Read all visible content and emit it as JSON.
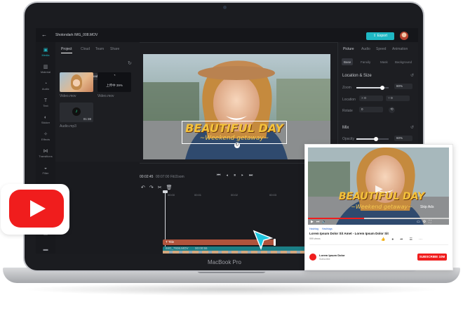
{
  "device": {
    "brand": "MacBook Pro"
  },
  "topbar": {
    "filename": "Shotondark IMG_008.MOV",
    "export_label": "Export"
  },
  "rail": {
    "items": [
      {
        "label": "Media",
        "icon": "media-icon"
      },
      {
        "label": "Material",
        "icon": "material-icon"
      },
      {
        "label": "Audio",
        "icon": "audio-icon"
      },
      {
        "label": "Text",
        "icon": "text-icon"
      },
      {
        "label": "Sticker",
        "icon": "sticker-icon"
      },
      {
        "label": "Effects",
        "icon": "effects-icon"
      },
      {
        "label": "Transitions",
        "icon": "transitions-icon"
      },
      {
        "label": "Filter",
        "icon": "filter-icon"
      }
    ]
  },
  "media_panel": {
    "tabs": [
      "Project",
      "Cloud",
      "Team",
      "Share"
    ],
    "upload_label": "Upload",
    "items": [
      {
        "name": "Video.mov"
      },
      {
        "name": "Video.mov",
        "overlay": "上传中 39%"
      },
      {
        "name": "Audio.mp3",
        "duration": "01:38"
      }
    ]
  },
  "right_panel": {
    "tabs": [
      "Picture",
      "Audio",
      "Speed",
      "Animation"
    ],
    "subtabs": [
      "Base",
      "Fanxily",
      "Mask",
      "Background"
    ],
    "location_title": "Location & Size",
    "zoom_label": "Zoom",
    "zoom_value": "80%",
    "zoom_level": 0.8,
    "position_label": "Location",
    "position_x": "0",
    "position_y": "0",
    "rotate_label": "Rotate",
    "rotate_value": "0",
    "mix_title": "Mix",
    "opacity_label": "Opacity",
    "opacity_value": "60%",
    "opacity_level": 0.6
  },
  "preview": {
    "headline": "BEAUTIFUL DAY",
    "subline": "~Weekend getaway~"
  },
  "timeline": {
    "current_time": "00:02:45",
    "total_time": "00:07:00",
    "fit_label": "Fit/Zoom",
    "ruler": [
      "00:00",
      "00:01",
      "00:02",
      "00:03",
      "00:04"
    ],
    "text_clip": "Title",
    "video_clip_name": "IMG_7936.MOV",
    "video_clip_duration": "00:00:55"
  },
  "youtube_card": {
    "headline": "BEAUTIFUL DAY",
    "subline": "~Weekend getaway~",
    "skip_label": "Skip Ads",
    "tags": [
      "Hashtag",
      "Hashtags"
    ],
    "title": "Lorem Ipsum Dolor Sit Amet - Lorem Ipsum Dolor Sit",
    "views": "999 views",
    "channel_name": "Lorem Ipsum Dolor",
    "channel_subs": "Subscribe",
    "subscribe_label": "SUBSCRIBE 10M"
  },
  "colors": {
    "accent": "#1fb8c4",
    "youtube_red": "#f01d1d",
    "clip_brown": "#b0533c",
    "clip_teal": "#1b7f86"
  }
}
